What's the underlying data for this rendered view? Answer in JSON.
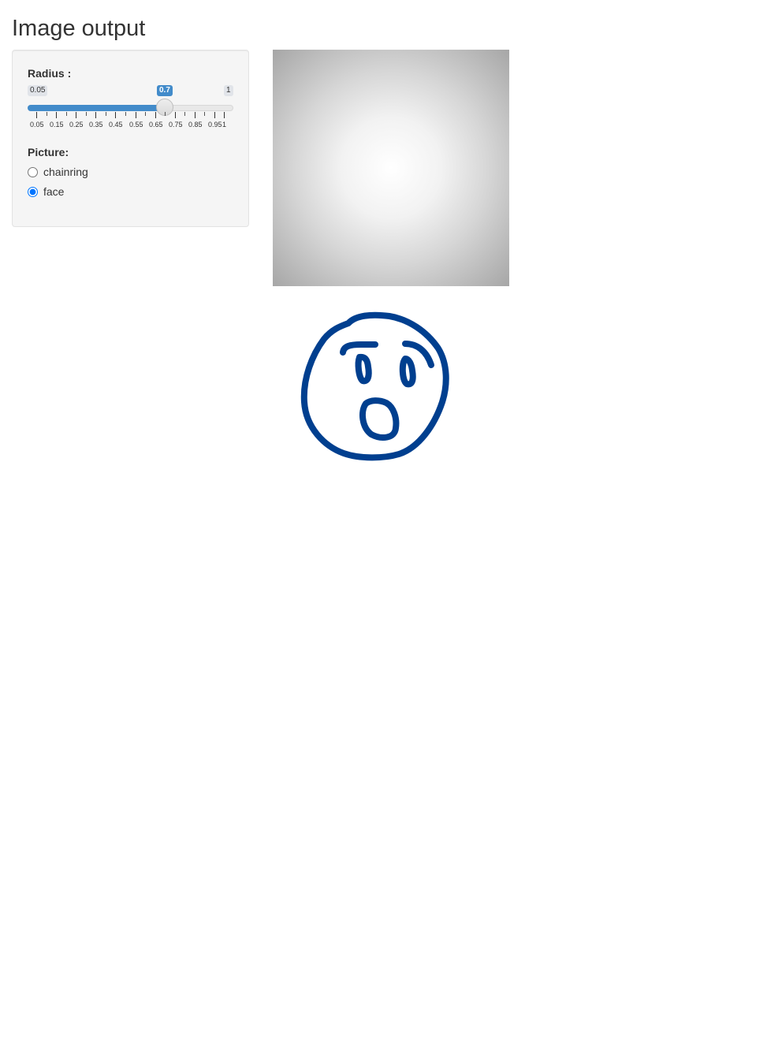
{
  "page": {
    "title": "Image output"
  },
  "radius_slider": {
    "label": "Radius :",
    "min_label": "0.05",
    "max_label": "1",
    "value": 0.7,
    "value_label": "0.7",
    "ticks": [
      "0.05",
      "0.15",
      "0.25",
      "0.35",
      "0.45",
      "0.55",
      "0.65",
      "0.75",
      "0.85",
      "0.95",
      "1"
    ],
    "accent_color": "#428bca"
  },
  "picture": {
    "label": "Picture:",
    "options": [
      {
        "label": "chainring",
        "selected": false
      },
      {
        "label": "face",
        "selected": true
      }
    ]
  },
  "images": {
    "gradient": {
      "icon": "radial-gradient-image"
    },
    "face": {
      "icon": "surprised-face-drawing",
      "stroke_color": "#003f8f"
    }
  }
}
